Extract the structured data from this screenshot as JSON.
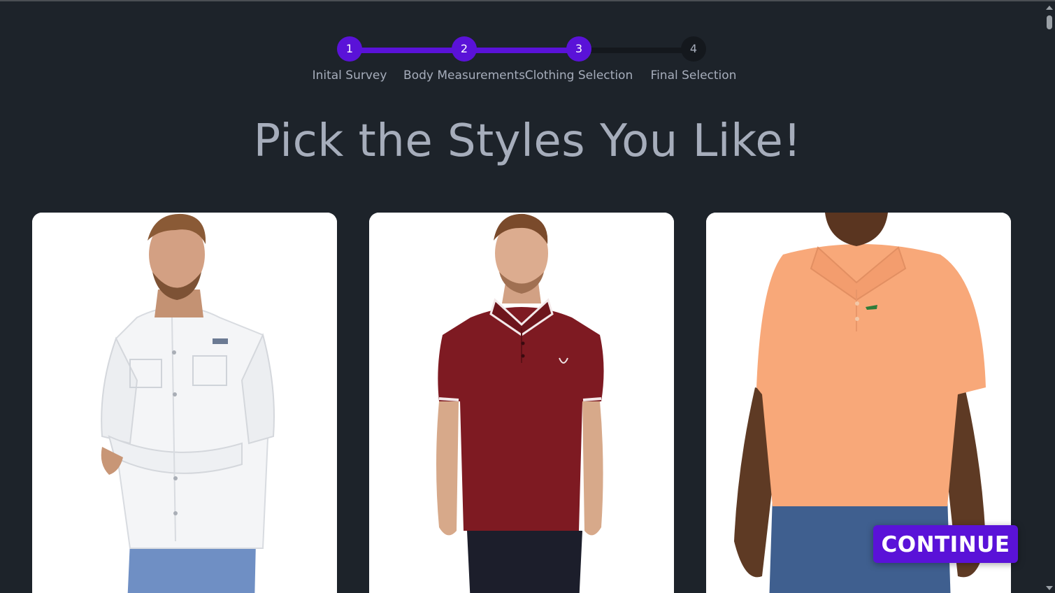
{
  "stepper": {
    "steps": [
      {
        "number": "1",
        "label": "Inital Survey",
        "state": "complete"
      },
      {
        "number": "2",
        "label": "Body Measurements",
        "state": "complete"
      },
      {
        "number": "3",
        "label": "Clothing Selection",
        "state": "current"
      },
      {
        "number": "4",
        "label": "Final Selection",
        "state": "upcoming"
      }
    ]
  },
  "page": {
    "title": "Pick the Styles You Like!"
  },
  "cards": [
    {
      "description": "Man in white button-up fishing shirt with rolled sleeves and blue pants"
    },
    {
      "description": "Man in burgundy polo shirt with white-tipped collar and cuffs and dark jeans"
    },
    {
      "description": "Man in peach polo shirt with green crocodile logo and blue jeans"
    }
  ],
  "actions": {
    "continue_label": "CONTINUE"
  },
  "colors": {
    "background": "#1d232a",
    "accent": "#5a12d8",
    "text_muted": "#a6adbb",
    "card": "#ffffff"
  }
}
